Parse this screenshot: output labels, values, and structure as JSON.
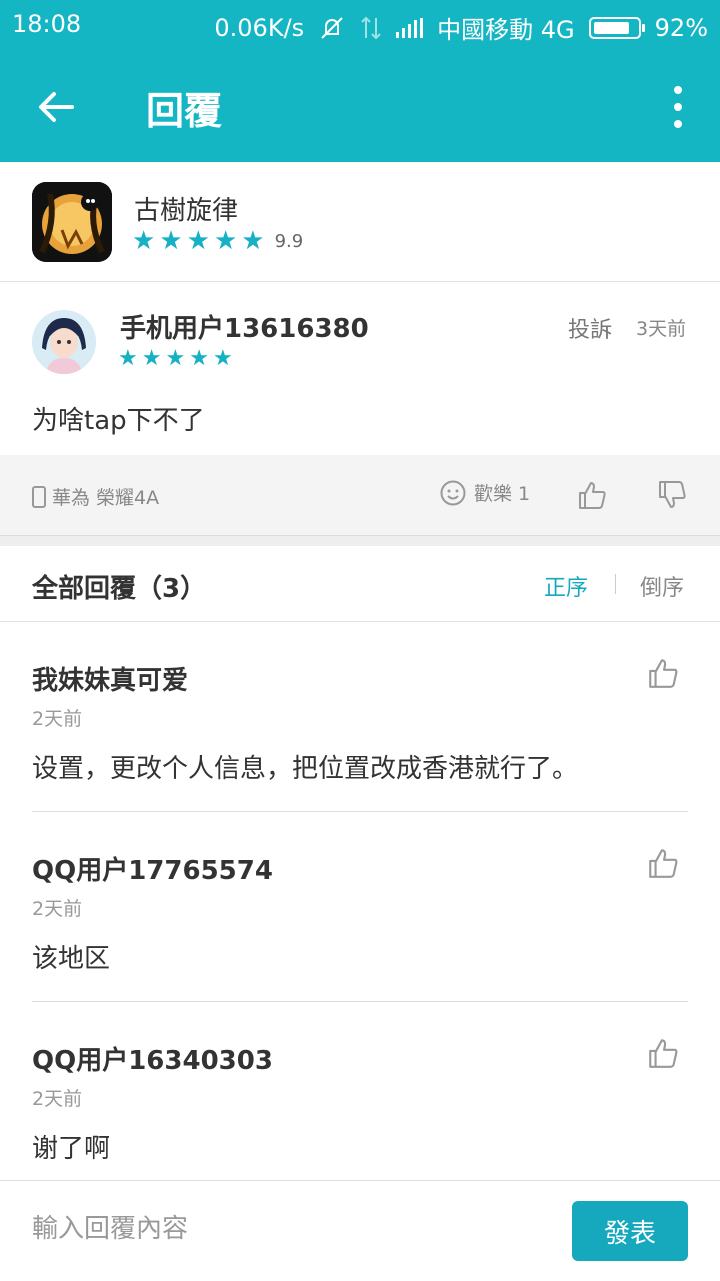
{
  "status_bar": {
    "time": "18:08",
    "network_speed": "0.06K/s",
    "carrier": "中國移動 4G",
    "battery": "92%",
    "battery_level": 0.92
  },
  "header": {
    "title": "回覆",
    "back_icon": "arrow-left-icon",
    "menu_icon": "more-vertical-icon"
  },
  "app": {
    "name": "古樹旋律",
    "score": "9.9",
    "stars": 5
  },
  "comment": {
    "user": "手机用户13616380",
    "stars": 5,
    "report_label": "投訴",
    "time": "3天前",
    "text": "为啥tap下不了",
    "device": "華為 榮耀4A",
    "happy_label": "歡樂 1"
  },
  "replies_header": {
    "title": "全部回覆（3）",
    "sort_asc": "正序",
    "sort_desc": "倒序"
  },
  "replies": [
    {
      "user": "我妹妹真可爱",
      "time": "2天前",
      "text": "设置，更改个人信息，把位置改成香港就行了。"
    },
    {
      "user": "QQ用户17765574",
      "time": "2天前",
      "text": "该地区"
    },
    {
      "user": "QQ用户16340303",
      "time": "2天前",
      "text": "谢了啊"
    }
  ],
  "input": {
    "placeholder": "輸入回覆內容",
    "submit_label": "發表"
  },
  "colors": {
    "accent": "#15b6c4",
    "button": "#16a9be",
    "star": "#16b1c4"
  }
}
